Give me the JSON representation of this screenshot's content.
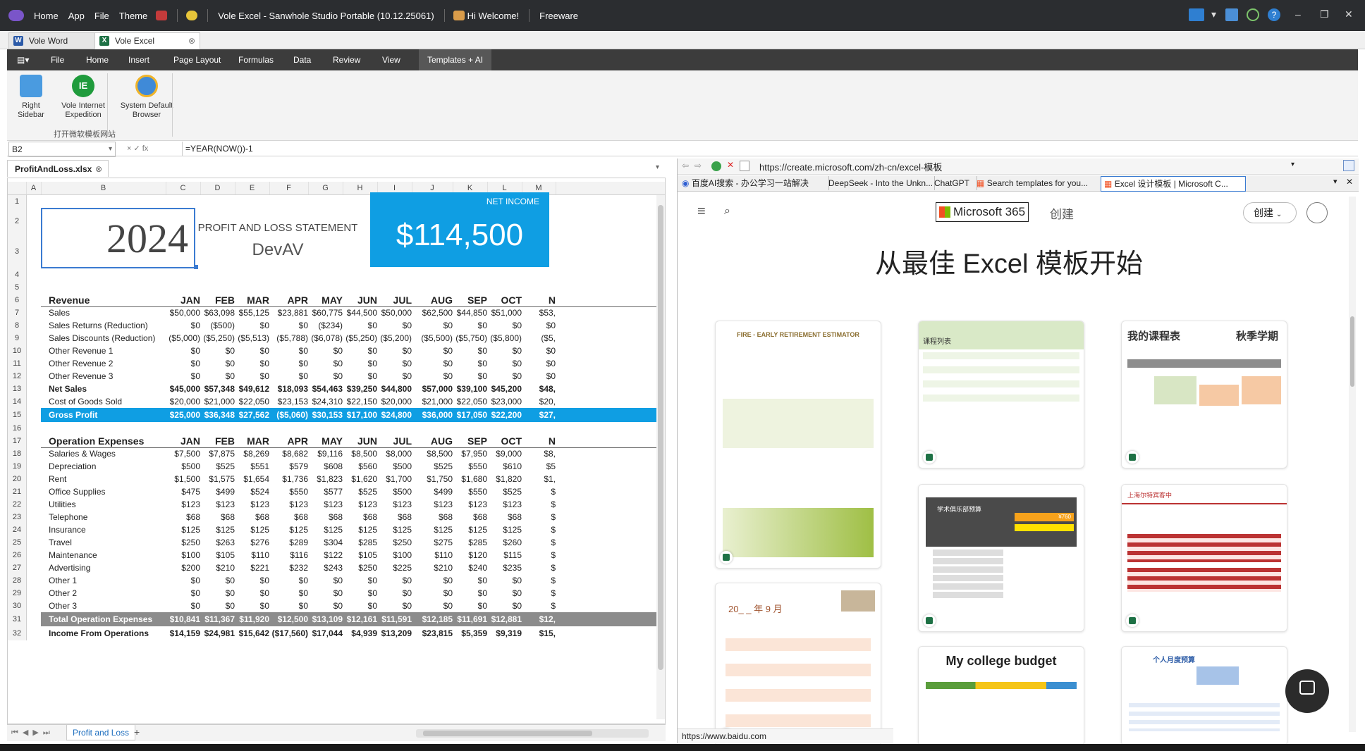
{
  "titlebar": {
    "menu": [
      "Home",
      "App",
      "File",
      "Theme"
    ],
    "title": "Vole Excel - Sanwhole Studio Portable (10.12.25061)",
    "greeting": "Hi Welcome!",
    "license": "Freeware"
  },
  "doc_tabs": [
    "Vole Word",
    "Vole Excel"
  ],
  "menubar": [
    "File",
    "Home",
    "Insert",
    "Page Layout",
    "Formulas",
    "Data",
    "Review",
    "View",
    "Templates + AI"
  ],
  "ribbon": {
    "buttons": [
      {
        "label1": "Right",
        "label2": "Sidebar"
      },
      {
        "label1": "Vole Internet",
        "label2": "Expedition"
      },
      {
        "label1": "System Default",
        "label2": "Browser"
      }
    ],
    "group_label": "打开微软模板网站"
  },
  "formula": {
    "namebox": "B2",
    "fx_buttons": "×  ✓  fx",
    "text": "=YEAR(NOW())-1"
  },
  "workbook": {
    "file": "ProfitAndLoss.xlsx",
    "sheet_tab": "Profit and Loss"
  },
  "sheet": {
    "columns": [
      "A",
      "B",
      "C",
      "D",
      "E",
      "F",
      "G",
      "H",
      "I",
      "J",
      "K",
      "L",
      "M"
    ],
    "year": "2024",
    "statement_title": "PROFIT AND LOSS STATEMENT",
    "company": "DevAV",
    "net_income_label": "NET INCOME",
    "net_income_value": "$114,500",
    "months": [
      "JAN",
      "FEB",
      "MAR",
      "APR",
      "MAY",
      "JUN",
      "JUL",
      "AUG",
      "SEP",
      "OCT",
      "N"
    ],
    "revenue_header": "Revenue",
    "revenue_rows": [
      {
        "label": "Sales",
        "v": [
          "$50,000",
          "$63,098",
          "$55,125",
          "$23,881",
          "$60,775",
          "$44,500",
          "$50,000",
          "$62,500",
          "$44,850",
          "$51,000",
          "$53,"
        ]
      },
      {
        "label": "Sales Returns (Reduction)",
        "v": [
          "$0",
          "($500)",
          "$0",
          "$0",
          "($234)",
          "$0",
          "$0",
          "$0",
          "$0",
          "$0",
          "$0"
        ]
      },
      {
        "label": "Sales Discounts (Reduction)",
        "v": [
          "($5,000)",
          "($5,250)",
          "($5,513)",
          "($5,788)",
          "($6,078)",
          "($5,250)",
          "($5,200)",
          "($5,500)",
          "($5,750)",
          "($5,800)",
          "($5,"
        ]
      },
      {
        "label": "Other Revenue 1",
        "v": [
          "$0",
          "$0",
          "$0",
          "$0",
          "$0",
          "$0",
          "$0",
          "$0",
          "$0",
          "$0",
          "$0"
        ]
      },
      {
        "label": "Other Revenue 2",
        "v": [
          "$0",
          "$0",
          "$0",
          "$0",
          "$0",
          "$0",
          "$0",
          "$0",
          "$0",
          "$0",
          "$0"
        ]
      },
      {
        "label": "Other Revenue 3",
        "v": [
          "$0",
          "$0",
          "$0",
          "$0",
          "$0",
          "$0",
          "$0",
          "$0",
          "$0",
          "$0",
          "$0"
        ]
      }
    ],
    "net_sales": {
      "label": "Net Sales",
      "v": [
        "$45,000",
        "$57,348",
        "$49,612",
        "$18,093",
        "$54,463",
        "$39,250",
        "$44,800",
        "$57,000",
        "$39,100",
        "$45,200",
        "$48,"
      ]
    },
    "cogs": {
      "label": "Cost of Goods Sold",
      "v": [
        "$20,000",
        "$21,000",
        "$22,050",
        "$23,153",
        "$24,310",
        "$22,150",
        "$20,000",
        "$21,000",
        "$22,050",
        "$23,000",
        "$20,"
      ]
    },
    "gross_profit": {
      "label": "Gross Profit",
      "v": [
        "$25,000",
        "$36,348",
        "$27,562",
        "($5,060)",
        "$30,153",
        "$17,100",
        "$24,800",
        "$36,000",
        "$17,050",
        "$22,200",
        "$27,"
      ]
    },
    "opex_header": "Operation Expenses",
    "opex_rows": [
      {
        "label": "Salaries & Wages",
        "v": [
          "$7,500",
          "$7,875",
          "$8,269",
          "$8,682",
          "$9,116",
          "$8,500",
          "$8,000",
          "$8,500",
          "$7,950",
          "$9,000",
          "$8,"
        ]
      },
      {
        "label": "Depreciation",
        "v": [
          "$500",
          "$525",
          "$551",
          "$579",
          "$608",
          "$560",
          "$500",
          "$525",
          "$550",
          "$610",
          "$5"
        ]
      },
      {
        "label": "Rent",
        "v": [
          "$1,500",
          "$1,575",
          "$1,654",
          "$1,736",
          "$1,823",
          "$1,620",
          "$1,700",
          "$1,750",
          "$1,680",
          "$1,820",
          "$1,"
        ]
      },
      {
        "label": "Office Supplies",
        "v": [
          "$475",
          "$499",
          "$524",
          "$550",
          "$577",
          "$525",
          "$500",
          "$499",
          "$550",
          "$525",
          "$"
        ]
      },
      {
        "label": "Utilities",
        "v": [
          "$123",
          "$123",
          "$123",
          "$123",
          "$123",
          "$123",
          "$123",
          "$123",
          "$123",
          "$123",
          "$"
        ]
      },
      {
        "label": "Telephone",
        "v": [
          "$68",
          "$68",
          "$68",
          "$68",
          "$68",
          "$68",
          "$68",
          "$68",
          "$68",
          "$68",
          "$"
        ]
      },
      {
        "label": "Insurance",
        "v": [
          "$125",
          "$125",
          "$125",
          "$125",
          "$125",
          "$125",
          "$125",
          "$125",
          "$125",
          "$125",
          "$"
        ]
      },
      {
        "label": "Travel",
        "v": [
          "$250",
          "$263",
          "$276",
          "$289",
          "$304",
          "$285",
          "$250",
          "$275",
          "$285",
          "$260",
          "$"
        ]
      },
      {
        "label": "Maintenance",
        "v": [
          "$100",
          "$105",
          "$110",
          "$116",
          "$122",
          "$105",
          "$100",
          "$110",
          "$120",
          "$115",
          "$"
        ]
      },
      {
        "label": "Advertising",
        "v": [
          "$200",
          "$210",
          "$221",
          "$232",
          "$243",
          "$250",
          "$225",
          "$210",
          "$240",
          "$235",
          "$"
        ]
      },
      {
        "label": "Other 1",
        "v": [
          "$0",
          "$0",
          "$0",
          "$0",
          "$0",
          "$0",
          "$0",
          "$0",
          "$0",
          "$0",
          "$"
        ]
      },
      {
        "label": "Other 2",
        "v": [
          "$0",
          "$0",
          "$0",
          "$0",
          "$0",
          "$0",
          "$0",
          "$0",
          "$0",
          "$0",
          "$"
        ]
      },
      {
        "label": "Other 3",
        "v": [
          "$0",
          "$0",
          "$0",
          "$0",
          "$0",
          "$0",
          "$0",
          "$0",
          "$0",
          "$0",
          "$"
        ]
      }
    ],
    "total_opex": {
      "label": "Total Operation Expenses",
      "v": [
        "$10,841",
        "$11,367",
        "$11,920",
        "$12,500",
        "$13,109",
        "$12,161",
        "$11,591",
        "$12,185",
        "$11,691",
        "$12,881",
        "$12,"
      ]
    },
    "income_ops": {
      "label": "Income From Operations",
      "v": [
        "$14,159",
        "$24,981",
        "$15,642",
        "($17,560)",
        "$17,044",
        "$4,939",
        "$13,209",
        "$23,815",
        "$5,359",
        "$9,319",
        "$15,"
      ]
    }
  },
  "browser": {
    "url": "https://create.microsoft.com/zh-cn/excel-模板",
    "tabs": [
      "百度AI搜索 - 办公学习一站解决",
      "DeepSeek - Into the Unkn...",
      "ChatGPT",
      "Search templates for you...",
      "Excel 设计模板 | Microsoft C..."
    ],
    "brand": "Microsoft 365",
    "create_nav": "创建",
    "create_btn": "创建",
    "hero": "从最佳 Excel 模板开始",
    "status_url": "https://www.baidu.com",
    "cards": {
      "fire_title": "FIRE - EARLY RETIREMENT ESTIMATOR",
      "course_list": "课程列表",
      "my_schedule": "我的课程表",
      "semester": "秋季学期",
      "club_budget": "学术俱乐部预算",
      "club_amount": "¥760",
      "restaurant": "上海尔特宾客中",
      "calendar": "20_ _ 年 9 月",
      "college_budget": "My college budget",
      "personal_budget": "个人月度预算"
    }
  }
}
